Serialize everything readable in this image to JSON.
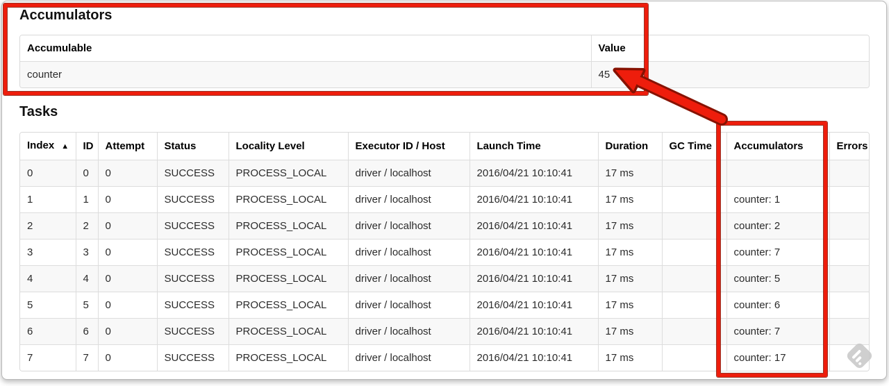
{
  "accumulators_section": {
    "title": "Accumulators",
    "table": {
      "col_accumulable": "Accumulable",
      "col_value": "Value",
      "row": {
        "accumulable": "counter",
        "value": "45"
      }
    }
  },
  "tasks_section": {
    "title": "Tasks",
    "table": {
      "headers": {
        "index": "Index",
        "sort_icon": "▲",
        "id": "ID",
        "attempt": "Attempt",
        "status": "Status",
        "locality_level": "Locality Level",
        "executor_id_host": "Executor ID / Host",
        "launch_time": "Launch Time",
        "duration": "Duration",
        "gc_time": "GC Time",
        "accumulators": "Accumulators",
        "errors": "Errors"
      },
      "rows": [
        {
          "index": "0",
          "id": "0",
          "attempt": "0",
          "status": "SUCCESS",
          "locality_level": "PROCESS_LOCAL",
          "executor_id_host": "driver / localhost",
          "launch_time": "2016/04/21 10:10:41",
          "duration": "17 ms",
          "gc_time": "",
          "accumulators": "",
          "errors": ""
        },
        {
          "index": "1",
          "id": "1",
          "attempt": "0",
          "status": "SUCCESS",
          "locality_level": "PROCESS_LOCAL",
          "executor_id_host": "driver / localhost",
          "launch_time": "2016/04/21 10:10:41",
          "duration": "17 ms",
          "gc_time": "",
          "accumulators": "counter: 1",
          "errors": ""
        },
        {
          "index": "2",
          "id": "2",
          "attempt": "0",
          "status": "SUCCESS",
          "locality_level": "PROCESS_LOCAL",
          "executor_id_host": "driver / localhost",
          "launch_time": "2016/04/21 10:10:41",
          "duration": "17 ms",
          "gc_time": "",
          "accumulators": "counter: 2",
          "errors": ""
        },
        {
          "index": "3",
          "id": "3",
          "attempt": "0",
          "status": "SUCCESS",
          "locality_level": "PROCESS_LOCAL",
          "executor_id_host": "driver / localhost",
          "launch_time": "2016/04/21 10:10:41",
          "duration": "17 ms",
          "gc_time": "",
          "accumulators": "counter: 7",
          "errors": ""
        },
        {
          "index": "4",
          "id": "4",
          "attempt": "0",
          "status": "SUCCESS",
          "locality_level": "PROCESS_LOCAL",
          "executor_id_host": "driver / localhost",
          "launch_time": "2016/04/21 10:10:41",
          "duration": "17 ms",
          "gc_time": "",
          "accumulators": "counter: 5",
          "errors": ""
        },
        {
          "index": "5",
          "id": "5",
          "attempt": "0",
          "status": "SUCCESS",
          "locality_level": "PROCESS_LOCAL",
          "executor_id_host": "driver / localhost",
          "launch_time": "2016/04/21 10:10:41",
          "duration": "17 ms",
          "gc_time": "",
          "accumulators": "counter: 6",
          "errors": ""
        },
        {
          "index": "6",
          "id": "6",
          "attempt": "0",
          "status": "SUCCESS",
          "locality_level": "PROCESS_LOCAL",
          "executor_id_host": "driver / localhost",
          "launch_time": "2016/04/21 10:10:41",
          "duration": "17 ms",
          "gc_time": "",
          "accumulators": "counter: 7",
          "errors": ""
        },
        {
          "index": "7",
          "id": "7",
          "attempt": "0",
          "status": "SUCCESS",
          "locality_level": "PROCESS_LOCAL",
          "executor_id_host": "driver / localhost",
          "launch_time": "2016/04/21 10:10:41",
          "duration": "17 ms",
          "gc_time": "",
          "accumulators": "counter: 17",
          "errors": ""
        }
      ]
    }
  },
  "annotations": {
    "highlight_color": "#ee1d0c",
    "outline_color": "#871202"
  },
  "watermark_color": "#c7c7c7"
}
